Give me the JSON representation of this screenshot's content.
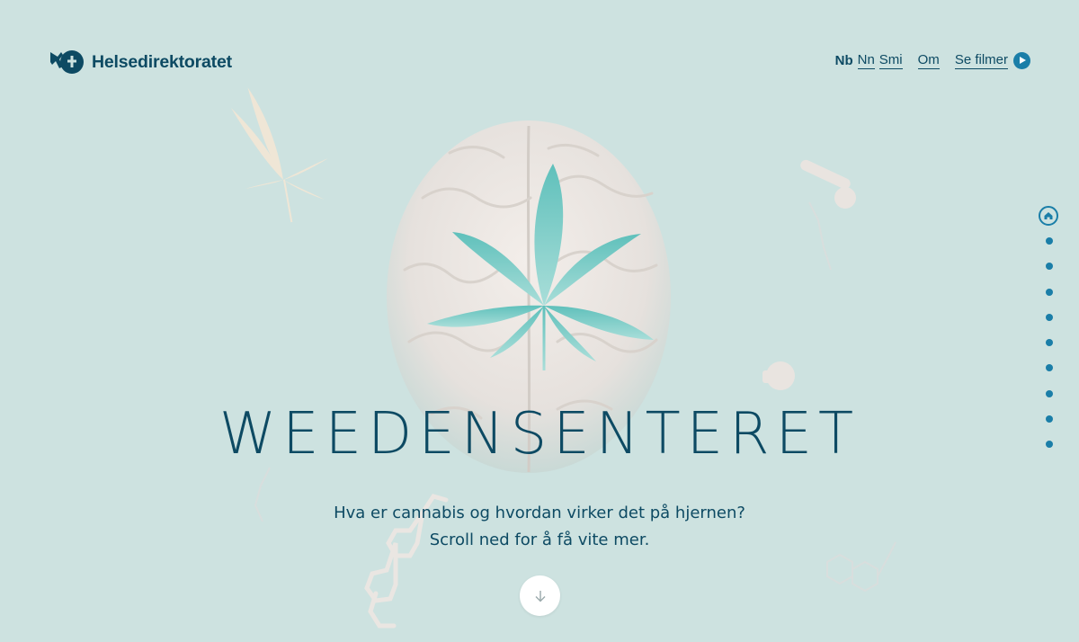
{
  "header": {
    "brand": "Helsedirektoratet",
    "languages": {
      "current": "Nb",
      "options": [
        "Nn",
        "Smi"
      ]
    },
    "about_label": "Om",
    "films_label": "Se filmer"
  },
  "hero": {
    "title": "WEEDENSENTERET",
    "subtitle_line1": "Hva er cannabis og hvordan virker det på hjernen?",
    "subtitle_line2": "Scroll ned for å få vite mer."
  },
  "pagination": {
    "total_sections": 10,
    "active_index": 0
  },
  "colors": {
    "background": "#cde2e0",
    "text": "#0d4a63",
    "accent": "#1a7ea8"
  },
  "icons": {
    "logo": "helsedirektoratet-logo-icon",
    "films": "play-icon",
    "scroll": "arrow-down-icon",
    "pager_home": "home-icon"
  }
}
